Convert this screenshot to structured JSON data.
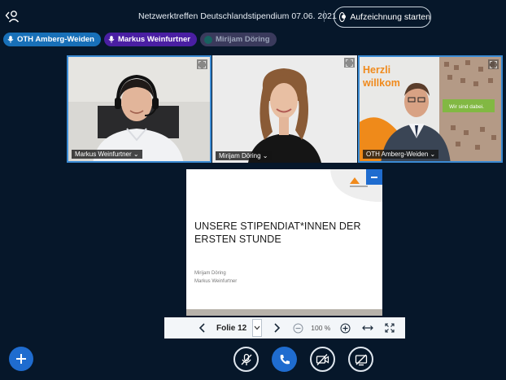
{
  "header": {
    "meeting_title": "Netzwerktreffen Deutschlandstipendium 07.06. 2021",
    "record_button": "Aufzeichnung starten"
  },
  "talkers": [
    {
      "name": "OTH Amberg-Weiden",
      "status": "talking",
      "color": "#1870b8"
    },
    {
      "name": "Markus Weinfurtner",
      "status": "talking",
      "color": "#4a1fa3"
    },
    {
      "name": "Mirijam Döring",
      "status": "idle",
      "color": "#3a3a5c"
    }
  ],
  "videos": [
    {
      "name": "Markus Weinfurtner ⌄"
    },
    {
      "name": "Mirijam Döring ⌄"
    },
    {
      "name": "OTH Amberg-Weiden ⌄"
    }
  ],
  "video_background_text": {
    "line1": "Herzli",
    "line2": "willkom",
    "banner": "Wir sind dabei."
  },
  "presentation": {
    "title_line1": "UNSERE STIPENDIAT*INNEN DER",
    "title_line2": "ERSTEN STUNDE",
    "presenter1": "Mirijam Döring",
    "presenter2": "Markus Weinfurtner"
  },
  "presentation_toolbar": {
    "slide_label": "Folie 12",
    "zoom": "100 %"
  },
  "controls": [
    "unmute-microphone",
    "leave-audio",
    "share-webcam",
    "share-screen"
  ],
  "colors": {
    "background": "#06172a",
    "accent": "#1f6ccf",
    "speaking_border": "#3b8bd4"
  }
}
